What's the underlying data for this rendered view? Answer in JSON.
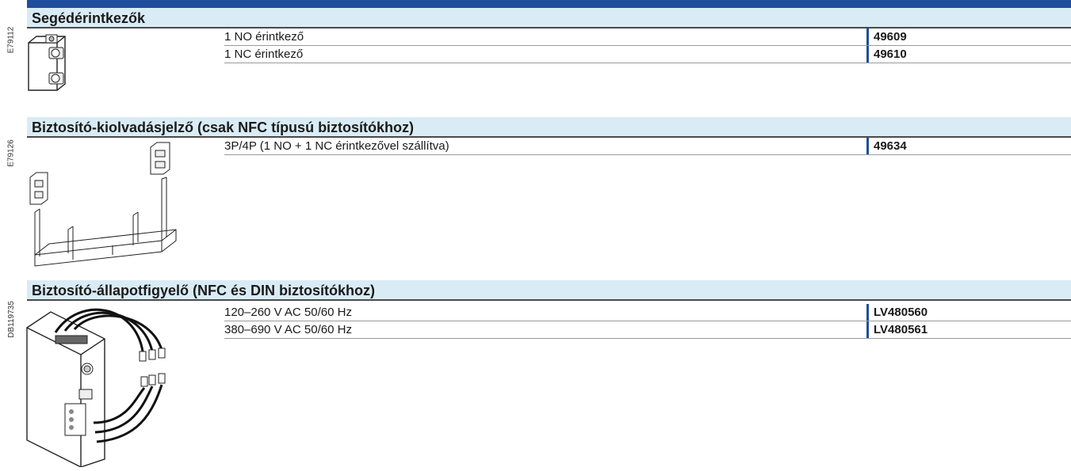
{
  "sections": [
    {
      "title": "Segédérintkezők",
      "image_ref": "E79112",
      "items": [
        {
          "description": "1 NO érintkező",
          "code": "49609"
        },
        {
          "description": "1 NC érintkező",
          "code": "49610"
        }
      ]
    },
    {
      "title": "Biztosító-kiolvadásjelző (csak NFC típusú biztosítókhoz)",
      "image_ref": "E79126",
      "items": [
        {
          "description": "3P/4P (1 NO + 1 NC érintkezővel szállítva)",
          "code": "49634"
        }
      ]
    },
    {
      "title": "Biztosító-állapotfigyelő (NFC és DIN biztosítókhoz)",
      "image_ref": "DB119735",
      "items": [
        {
          "description": "120–260 V AC 50/60 Hz",
          "code": "LV480560"
        },
        {
          "description": "380–690 V AC 50/60 Hz",
          "code": "LV480561"
        }
      ]
    }
  ],
  "colors": {
    "accent": "#1f4e9c",
    "header_bg": "#d9ecf5"
  },
  "icons": [
    "auxiliary-contact-icon",
    "fuse-blown-indicator-icon",
    "fuse-monitor-icon"
  ]
}
